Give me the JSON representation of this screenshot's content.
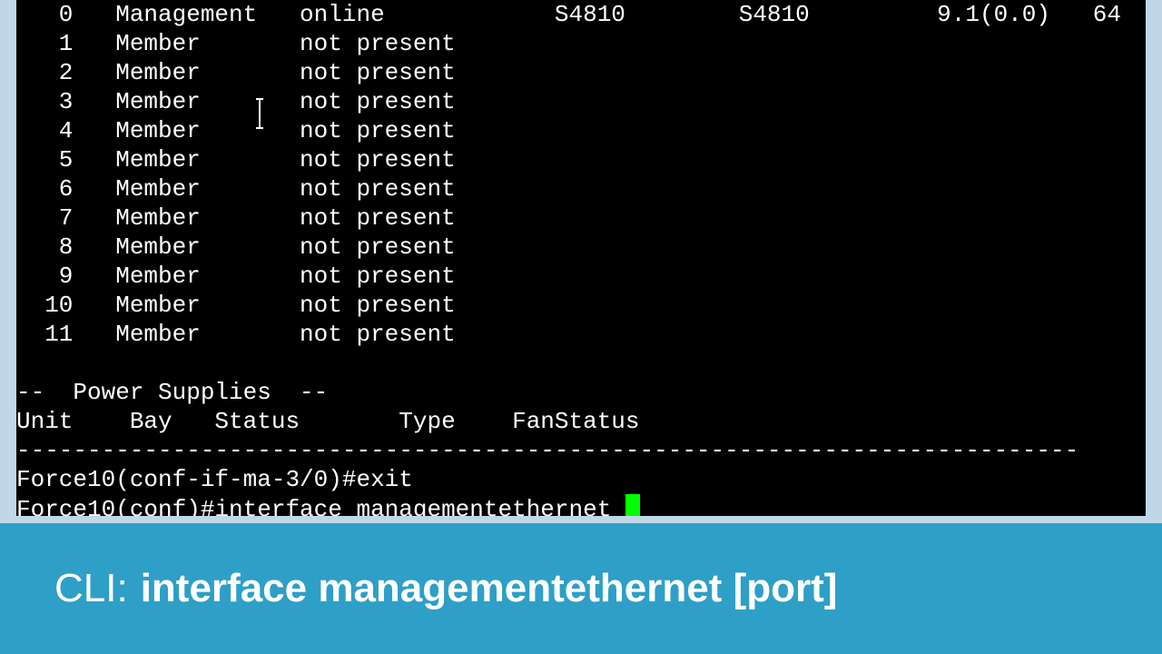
{
  "terminal": {
    "unit_rows": [
      {
        "unit": "0",
        "role": "Management",
        "status": "online",
        "type": "S4810",
        "model": "S4810",
        "version": "9.1(0.0)",
        "ports": "64"
      },
      {
        "unit": "1",
        "role": "Member",
        "status": "not present",
        "type": "",
        "model": "",
        "version": "",
        "ports": ""
      },
      {
        "unit": "2",
        "role": "Member",
        "status": "not present",
        "type": "",
        "model": "",
        "version": "",
        "ports": ""
      },
      {
        "unit": "3",
        "role": "Member",
        "status": "not present",
        "type": "",
        "model": "",
        "version": "",
        "ports": ""
      },
      {
        "unit": "4",
        "role": "Member",
        "status": "not present",
        "type": "",
        "model": "",
        "version": "",
        "ports": ""
      },
      {
        "unit": "5",
        "role": "Member",
        "status": "not present",
        "type": "",
        "model": "",
        "version": "",
        "ports": ""
      },
      {
        "unit": "6",
        "role": "Member",
        "status": "not present",
        "type": "",
        "model": "",
        "version": "",
        "ports": ""
      },
      {
        "unit": "7",
        "role": "Member",
        "status": "not present",
        "type": "",
        "model": "",
        "version": "",
        "ports": ""
      },
      {
        "unit": "8",
        "role": "Member",
        "status": "not present",
        "type": "",
        "model": "",
        "version": "",
        "ports": ""
      },
      {
        "unit": "9",
        "role": "Member",
        "status": "not present",
        "type": "",
        "model": "",
        "version": "",
        "ports": ""
      },
      {
        "unit": "10",
        "role": "Member",
        "status": "not present",
        "type": "",
        "model": "",
        "version": "",
        "ports": ""
      },
      {
        "unit": "11",
        "role": "Member",
        "status": "not present",
        "type": "",
        "model": "",
        "version": "",
        "ports": ""
      }
    ],
    "power_header": "--  Power Supplies  --",
    "power_columns": "Unit    Bay   Status       Type    FanStatus",
    "divider": "---------------------------------------------------------------------------",
    "prompt1_prefix": "Force10(conf-if-ma-3/0)#",
    "prompt1_cmd": "exit",
    "prompt2_prefix": "Force10(conf)#",
    "prompt2_cmd": "interface managementethernet "
  },
  "caption": {
    "prefix": "CLI:",
    "text": "interface managementethernet [port]"
  }
}
